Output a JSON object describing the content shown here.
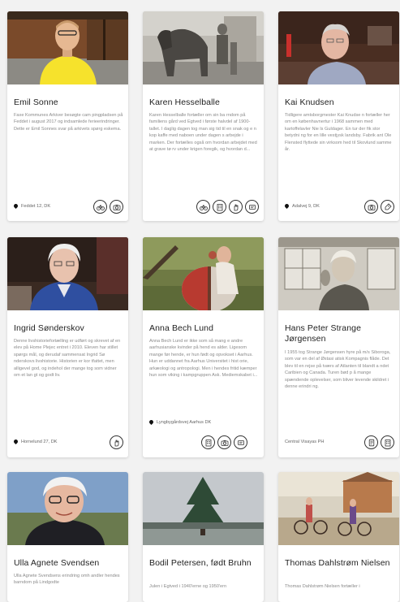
{
  "cards": [
    {
      "title": "Emil Sonne",
      "description": "Faxe Kommunes Arkiver besøgte cam pingpladsen på Feddet i august 2017 og indsamlede ferieerindringer. Dette er Emil Sonnes svar på arkivets spørg eskema.",
      "location": "Feddet 12, DK",
      "tags": [
        "bicycle-icon",
        "camera-icon"
      ]
    },
    {
      "title": "Karen Hesselballe",
      "description": "Karen Hesselballe fortæller om sin ba rndom på familiens gård ved Egtved i første halvdel af 1900-tallet. I daglig dagen tog man sig tid til en snak og e n kop kaffe med naboen under dagen s arbejde i marken. Der fortælles også om hvordan arbejdet med at grave tø rv under krigen foregik, og hvordan d...",
      "location": "",
      "tags": [
        "bicycle-icon",
        "building-icon",
        "hand-icon",
        "sign-icon"
      ]
    },
    {
      "title": "Kai Knudsen",
      "description": "Tidligere amtsborgmester Kai Knudse n fortæller her om en københavnertur i 1968 sammen med kartoffelavler Nie ls Guldager. En tur der fik stor betydni ng for en lille vestjysk landsby. Fabrik ant Ole Flensted flyttede sin virksom hed til Skovlund samme år.",
      "location": "Adalvej 9, DK",
      "tags": [
        "camera-icon",
        "tag-icon"
      ]
    },
    {
      "title": "Ingrid Sønderskov",
      "description": "Denne livshistoriefortælling er udført og skrevet af en elev på Home Plejec entret i 2010. Eleven har stillet spørgs mål, og derudaf sammensat Ingrid Sø nderskovs livshistorie. Historien er kor tfattet, men alligevel god, og indehol der mange tog som vidner om et lan gt og godt liv.",
      "location": "Hornelund 27, DK",
      "tags": [
        "hand-icon"
      ]
    },
    {
      "title": "Anna Bech Lund",
      "description": "Anna Bech Lund er ikke som så mang e andre aarhusianske kvinder på hend es alder. Ligesom mange før hende, er hun født og opvokset i Aarhus. Hun er uddannet fra Aarhus Universitet i hist orie, arkæologi og antropologi. Men i hendes fritid kæmper hun som viking i kampgruppen Ask. Mediemskabet i...",
      "location": "Lyngbygårdsvej Aarhus DK",
      "tags": [
        "building-icon",
        "camera-icon",
        "sign-icon"
      ]
    },
    {
      "title": "Hans Peter Strange Jørgensen",
      "description": "I 1955 tog Strange Jørgensen hyre på m/s Siboroga, som var en del af Østasi atisk Kompagnis flåde. Det blev til en rejse på tværs af Atlanten til blandt a ndet Caribien og Canada. Turen bød p å mange spændende oplevelser, som bliver levende skildret i denne erindri ng.",
      "location": "Central Visayas PH",
      "tags": [
        "document-icon",
        "building-icon"
      ]
    },
    {
      "title": "Ulla Agnete Svendsen",
      "description": "Ulla Agnete Svendsens erindring omh andler hendes barndom på Lindgodte",
      "location": "",
      "tags": []
    },
    {
      "title": "Bodil Petersen, født Bruhn",
      "description": "Julen i Egtved i 1940'erne og 1950'ern",
      "location": "",
      "tags": []
    },
    {
      "title": "Thomas Dahlstrøm Nielsen",
      "description": "Thomas Dahlstrøm Nielsen fortæller i",
      "location": "",
      "tags": []
    }
  ]
}
